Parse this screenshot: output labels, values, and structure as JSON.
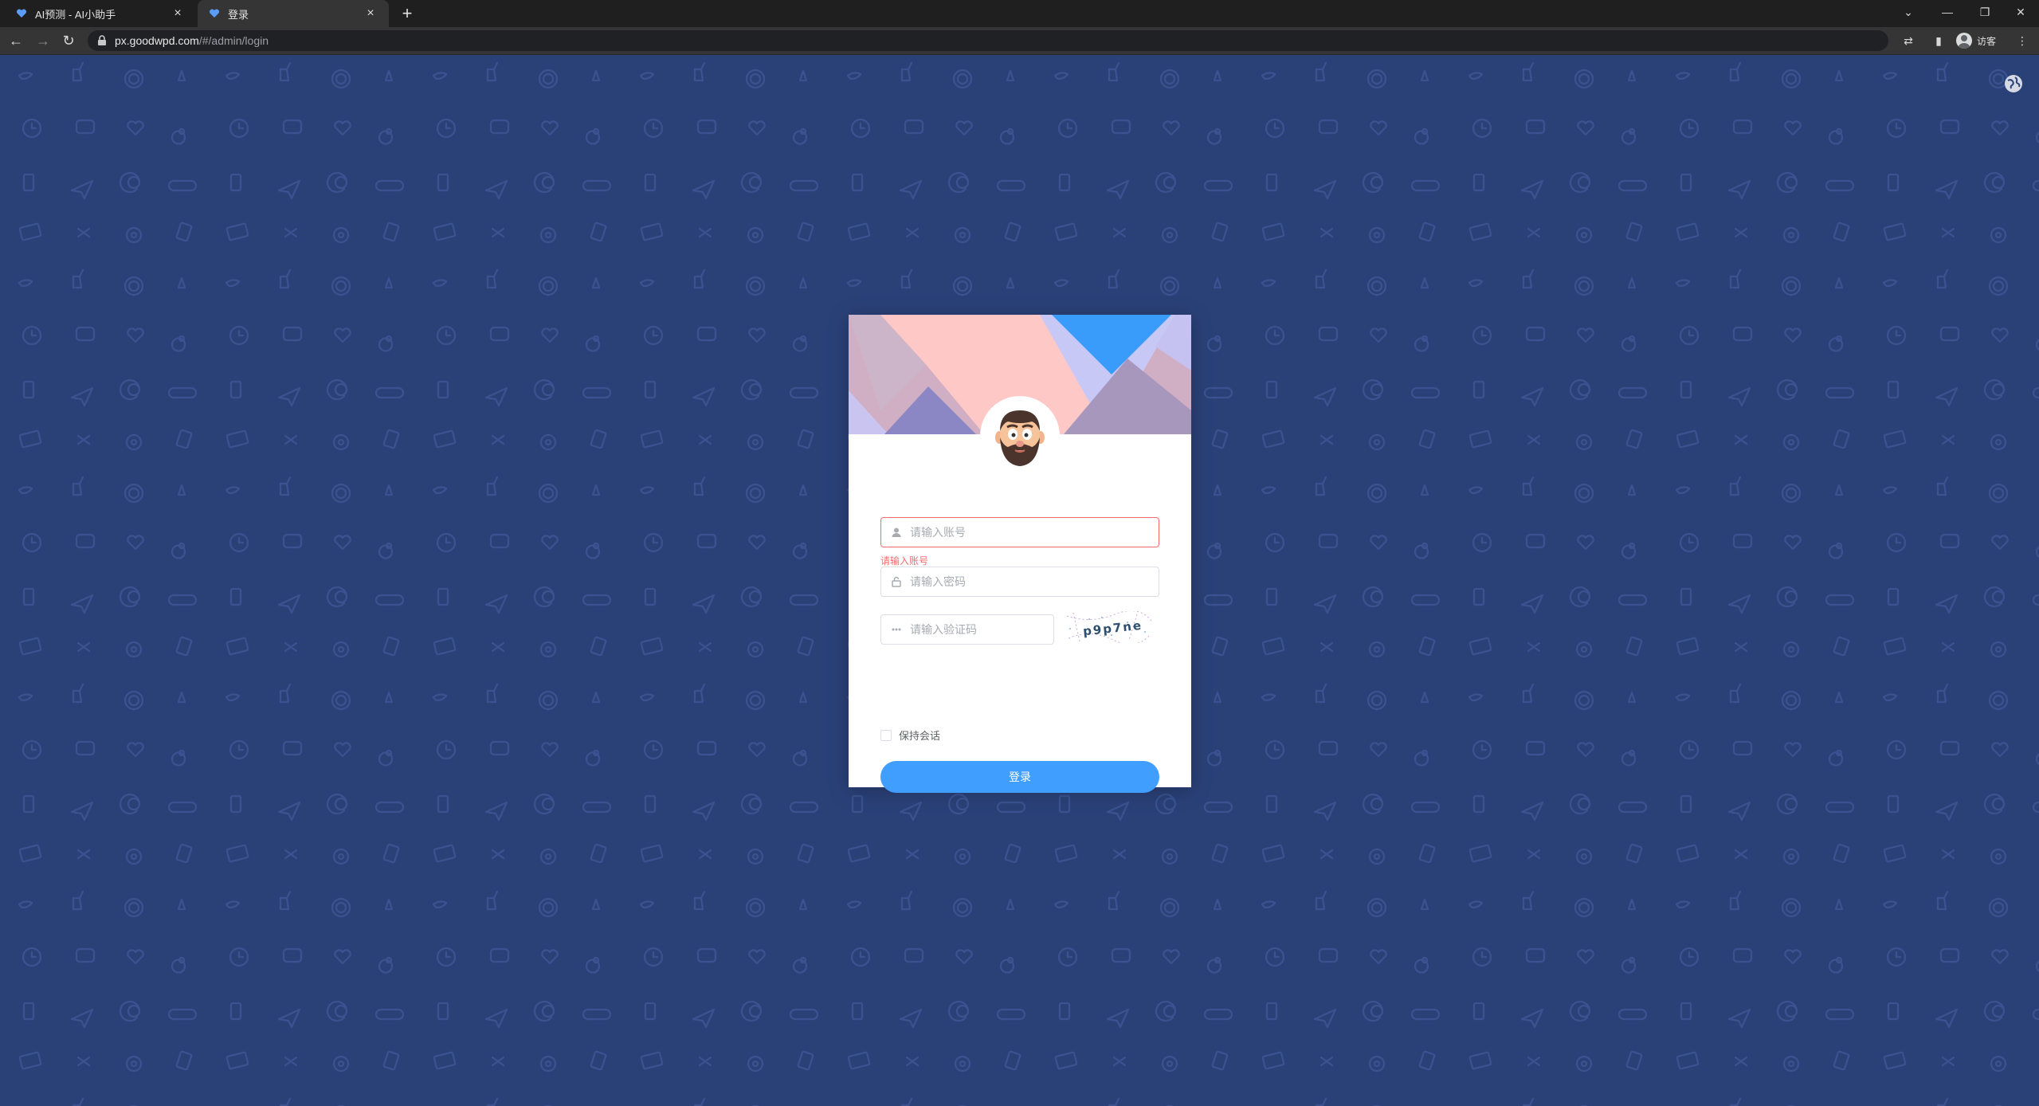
{
  "browser": {
    "tabs": [
      {
        "title": "AI预测 - AI小助手",
        "active": false
      },
      {
        "title": "登录",
        "active": true
      }
    ],
    "new_tab": "+",
    "url_host": "px.goodwpd.com",
    "url_path": "/#/admin/login",
    "profile_label": "访客",
    "window_controls": {
      "minimize": "—",
      "restore": "❐",
      "close": "✕"
    },
    "icons": [
      "back-icon",
      "forward-icon",
      "reload-icon",
      "lock-icon",
      "translate-icon",
      "sidebar-icon",
      "menu-icon"
    ]
  },
  "login": {
    "username_placeholder": "请输入账号",
    "username_error": "请输入账号",
    "password_placeholder": "请输入密码",
    "captcha_placeholder": "请输入验证码",
    "captcha_text": "p9p7ne",
    "remember_label": "保持会话",
    "submit_label": "登录"
  },
  "colors": {
    "background": "#2a4178",
    "primary": "#409eff",
    "error": "#f56c6c"
  }
}
